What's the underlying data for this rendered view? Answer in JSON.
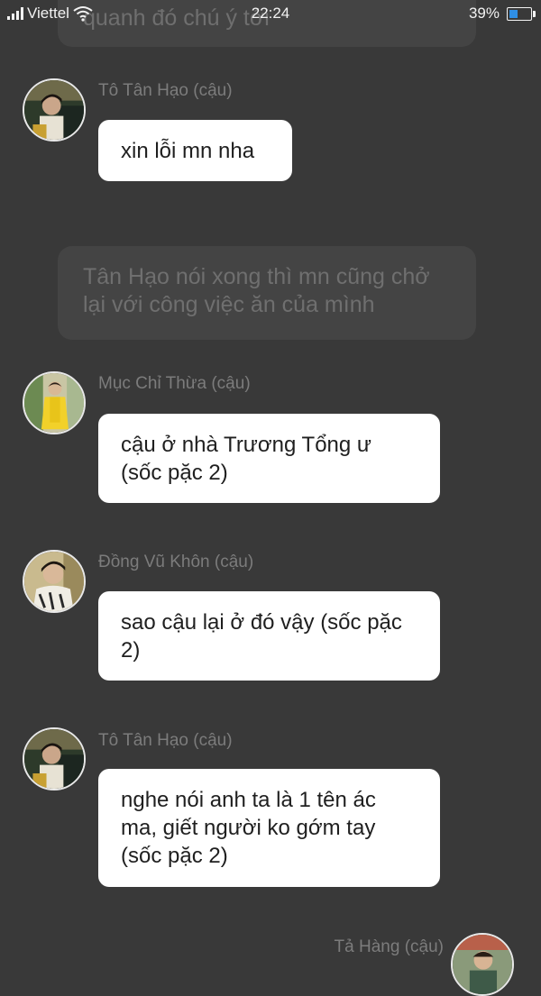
{
  "status_bar": {
    "carrier": "Viettel",
    "time": "22:24",
    "battery_percent": "39%",
    "battery_level": 0.39,
    "signal_icon": "signal-bars-icon",
    "wifi_icon": "wifi-icon"
  },
  "chat": {
    "narration_top": "quanh đó chú ý tới",
    "messages": [
      {
        "speaker": "Tô Tân Hạo (cậu)",
        "text": "xin lỗi mn nha"
      },
      {
        "speaker": "Mục Chỉ Thừa (cậu)",
        "text": "cậu ở nhà Trương Tổng ư (sốc pặc 2)"
      },
      {
        "speaker": "Đồng Vũ Khôn (cậu)",
        "text": "sao cậu lại ở đó vậy (sốc pặc 2)"
      },
      {
        "speaker": "Tô Tân Hạo (cậu)",
        "text": "nghe nói anh ta là 1 tên ác ma, giết người ko gớm tay (sốc pặc 2)"
      },
      {
        "speaker": "Tả Hàng (cậu)",
        "text": ""
      }
    ],
    "narration_middle": "Tân Hạo nói xong thì mn cũng chở lại với công việc ăn của mình"
  },
  "colors": {
    "background": "#393939",
    "narration_bg": "#444444",
    "narration_text": "#6f6f6f",
    "bubble_bg": "#ffffff",
    "speaker_text": "#7c7c7c",
    "battery_fill": "#2f8fe6"
  }
}
